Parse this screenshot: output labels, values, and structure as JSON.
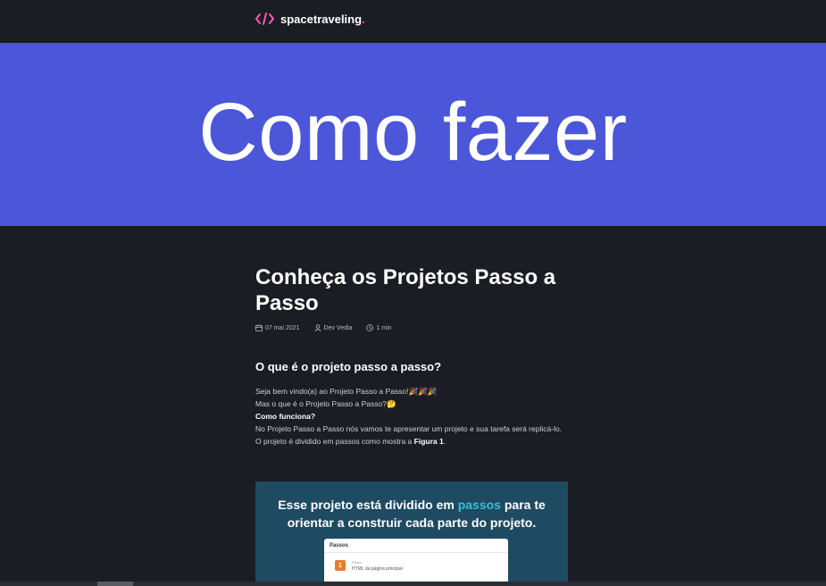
{
  "colors": {
    "background": "#1a1d23",
    "banner": "#4b56d8",
    "accent": "#ff57b2",
    "figure_bg": "#1e4a62",
    "figure_highlight": "#35c2cf",
    "step_badge": "#e97b2a"
  },
  "header": {
    "logo_icon": "code-brackets-icon",
    "brand": "spacetraveling",
    "brand_dot": "."
  },
  "banner": {
    "text": "Como fazer"
  },
  "post": {
    "title": "Conheça os Projetos Passo a Passo",
    "date": "07 mai 2021",
    "author": "Dev Vedia",
    "reading_time": "1 min",
    "date_icon": "calendar-icon",
    "author_icon": "user-icon",
    "time_icon": "clock-icon",
    "section_heading": "O que é o projeto passo a passo?",
    "p1": "Seja bem vindo(a) ao Projeto Passo a Passo!🎉🎉🎉",
    "p2": "Mas o que é o Projeto Passo a Passo?🤔",
    "p3_bold": "Como funciona?",
    "p4": "No Projeto Passo a Passo nós vamos te apresentar um projeto e sua tarefa será replicá-lo.",
    "p5_before": "O projeto é dividido em passos como mostra a ",
    "p5_bold": "Figura 1",
    "p5_after": "."
  },
  "figure": {
    "line1_before": "Esse projeto está dividido em ",
    "line1_highlight": "passos",
    "line1_after": " para te",
    "line2": "orientar a construir cada parte do projeto.",
    "card_title": "Passos",
    "step_number": "1",
    "step_label": "Passo",
    "step_desc": "HTML da página principal"
  }
}
